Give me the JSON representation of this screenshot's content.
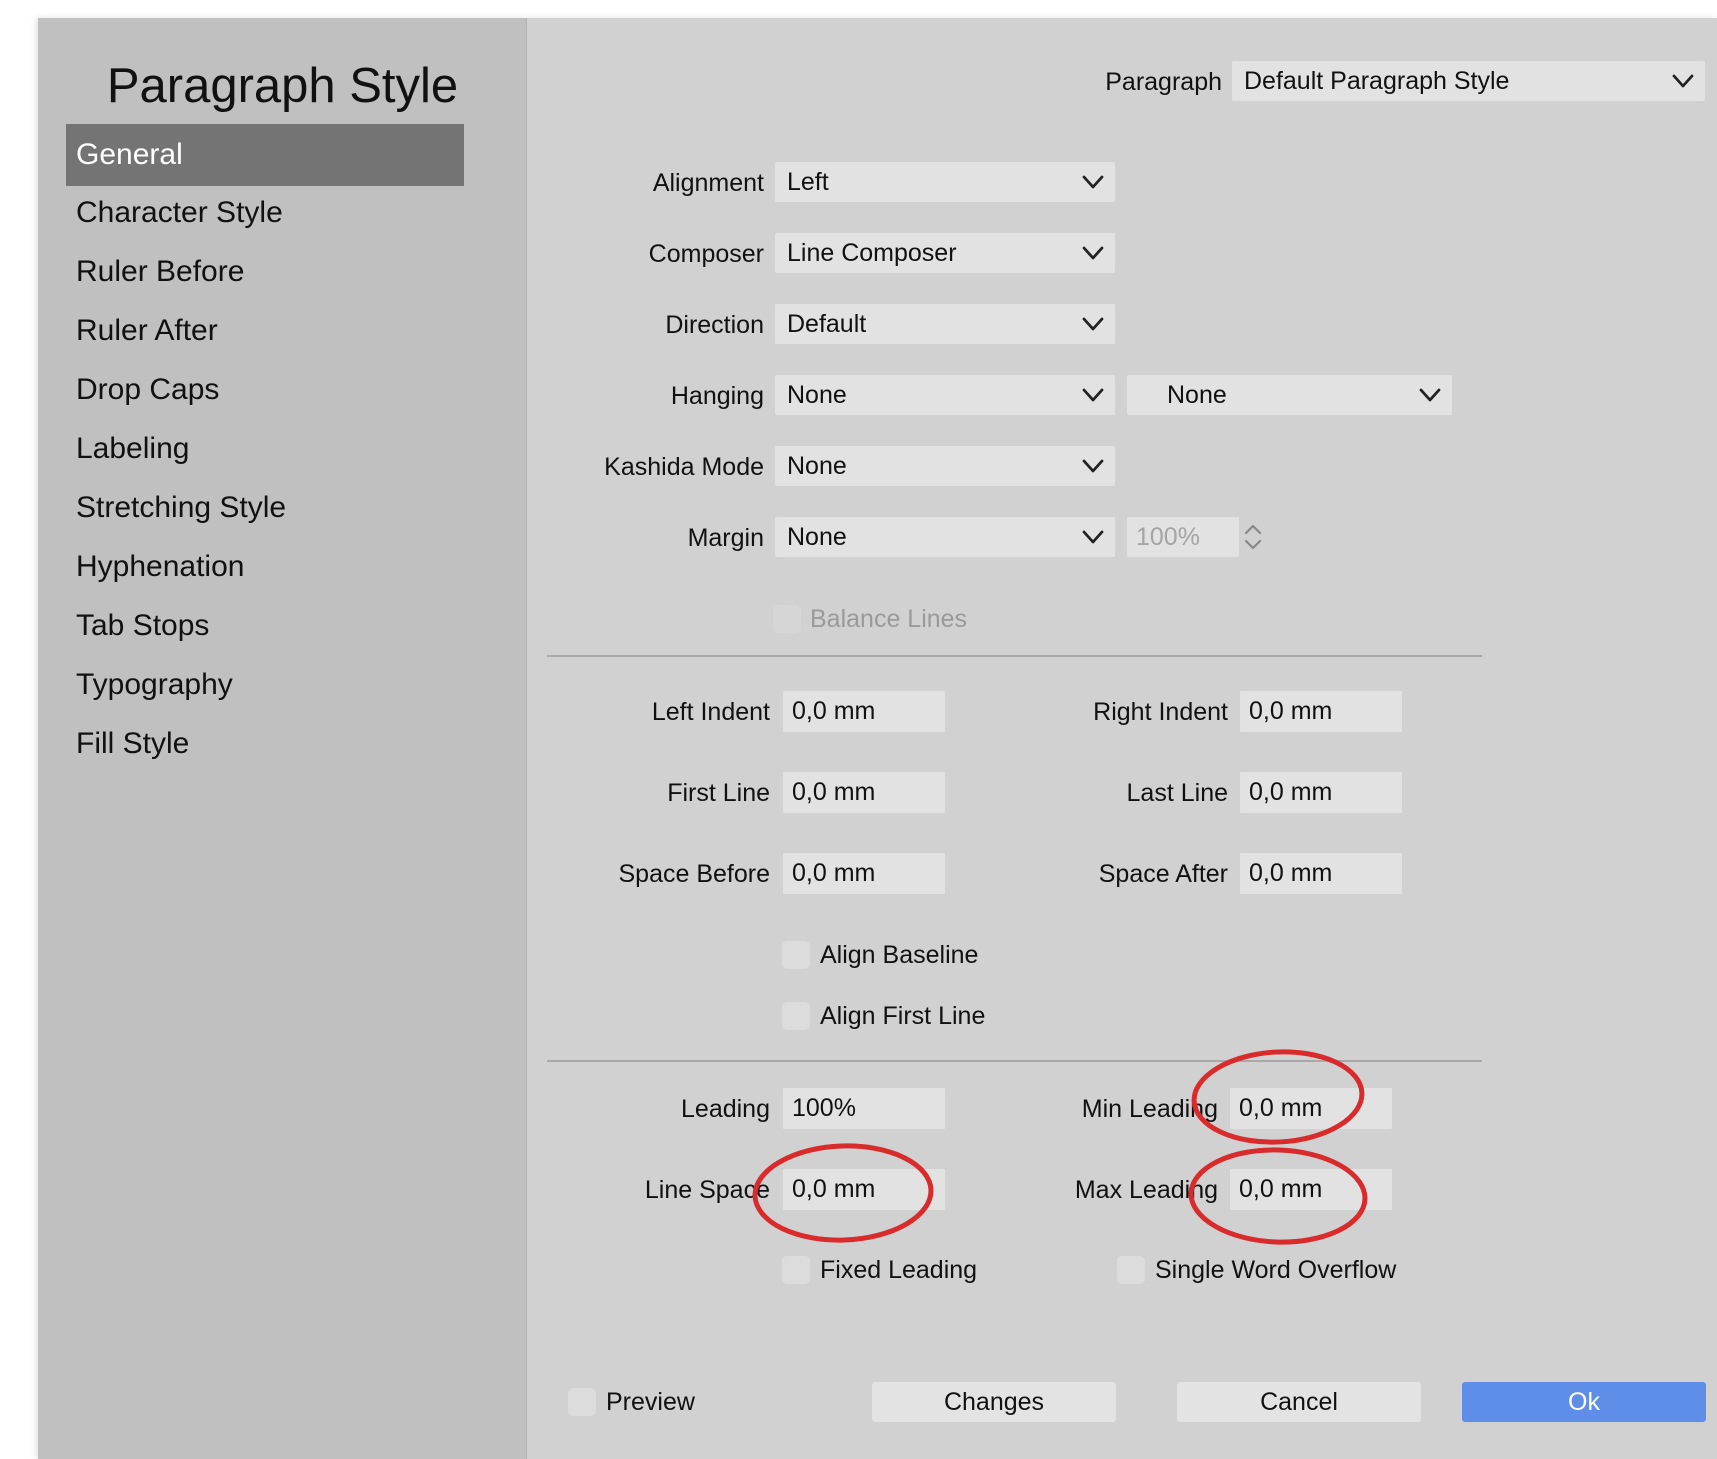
{
  "sidebar": {
    "title": "Paragraph Style",
    "items": [
      {
        "label": "General",
        "active": true
      },
      {
        "label": "Character Style"
      },
      {
        "label": "Ruler Before"
      },
      {
        "label": "Ruler After"
      },
      {
        "label": "Drop Caps"
      },
      {
        "label": "Labeling"
      },
      {
        "label": "Stretching Style"
      },
      {
        "label": "Hyphenation"
      },
      {
        "label": "Tab Stops"
      },
      {
        "label": "Typography"
      },
      {
        "label": "Fill Style"
      }
    ]
  },
  "header": {
    "paragraph_label": "Paragraph",
    "paragraph_value": "Default Paragraph Style"
  },
  "general": {
    "alignment": {
      "label": "Alignment",
      "value": "Left"
    },
    "composer": {
      "label": "Composer",
      "value": "Line Composer"
    },
    "direction": {
      "label": "Direction",
      "value": "Default"
    },
    "hanging": {
      "label": "Hanging",
      "value": "None",
      "value2": "None"
    },
    "kashida": {
      "label": "Kashida Mode",
      "value": "None"
    },
    "margin": {
      "label": "Margin",
      "value": "None",
      "percent": "100%"
    },
    "balance_lines": {
      "label": "Balance Lines",
      "checked": false,
      "enabled": false
    }
  },
  "indents": {
    "left_indent": {
      "label": "Left Indent",
      "value": "0,0 mm"
    },
    "right_indent": {
      "label": "Right Indent",
      "value": "0,0 mm"
    },
    "first_line": {
      "label": "First Line",
      "value": "0,0 mm"
    },
    "last_line": {
      "label": "Last Line",
      "value": "0,0 mm"
    },
    "space_before": {
      "label": "Space Before",
      "value": "0,0 mm"
    },
    "space_after": {
      "label": "Space After",
      "value": "0,0 mm"
    },
    "align_baseline": {
      "label": "Align Baseline",
      "checked": false
    },
    "align_first_line": {
      "label": "Align First Line",
      "checked": false
    }
  },
  "leading": {
    "leading": {
      "label": "Leading",
      "value": "100%"
    },
    "min_leading": {
      "label": "Min Leading",
      "value": "0,0 mm"
    },
    "line_space": {
      "label": "Line Space",
      "value": "0,0 mm"
    },
    "max_leading": {
      "label": "Max Leading",
      "value": "0,0 mm"
    },
    "fixed_leading": {
      "label": "Fixed Leading",
      "checked": false
    },
    "single_word_overflow": {
      "label": "Single Word Overflow",
      "checked": false
    }
  },
  "footer": {
    "preview": "Preview",
    "changes": "Changes",
    "cancel": "Cancel",
    "ok": "Ok"
  },
  "colors": {
    "accent": "#5f8ee8",
    "annotation": "#d92b2b",
    "sidebar": "#c0c0c0",
    "panel": "#d1d1d1"
  },
  "icons": {
    "dropdown": "chevron-down-icon",
    "stepper": "stepper-arrows-icon"
  }
}
